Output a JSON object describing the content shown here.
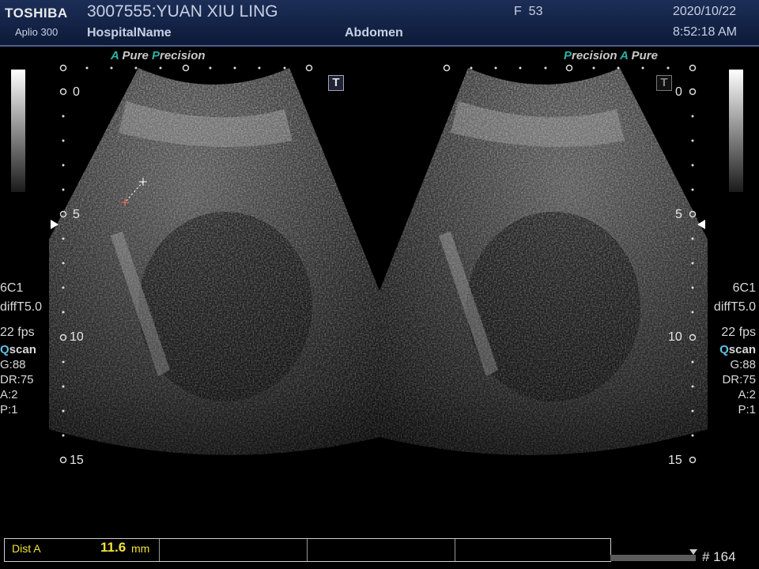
{
  "header": {
    "brand": "TOSHIBA",
    "model": "Aplio 300",
    "patient": "3007555:YUAN XIU LING",
    "hospital": "HospitalName",
    "sex_age": "F  53",
    "preset": "Abdomen",
    "date": "2020/10/22",
    "time": "8:52:18 AM"
  },
  "processing_labels": {
    "left_a": "A",
    "left_pure": "Pure",
    "left_p": "P",
    "left_precision": "recision",
    "right_p": "P",
    "right_precision": "recision",
    "right_a": "A",
    "right_pure": "Pure"
  },
  "left_panel": {
    "probe": "6C1",
    "mode": "diffT5.0",
    "fps": "22 fps",
    "qscan_q": "Q",
    "qscan_rest": "scan",
    "gain": "G:88",
    "dr": "DR:75",
    "a": "A:2",
    "p": "P:1"
  },
  "right_panel": {
    "probe": "6C1",
    "mode": "diffT5.0",
    "fps": "22 fps",
    "qscan_q": "Q",
    "qscan_rest": "scan",
    "gain": "G:88",
    "dr": "DR:75",
    "a": "A:2",
    "p": "P:1"
  },
  "depth_scale": [
    "0",
    "5",
    "10",
    "15"
  ],
  "toggle_icon": "T",
  "measurement": {
    "label": "Dist A",
    "value": "11.6",
    "unit": "mm"
  },
  "frame": "# 164",
  "colors": {
    "header_bg": "#13244a",
    "accent_teal": "#2bb3a9",
    "measurement_value": "#f2e23a",
    "qscan": "#5ec1e0"
  }
}
